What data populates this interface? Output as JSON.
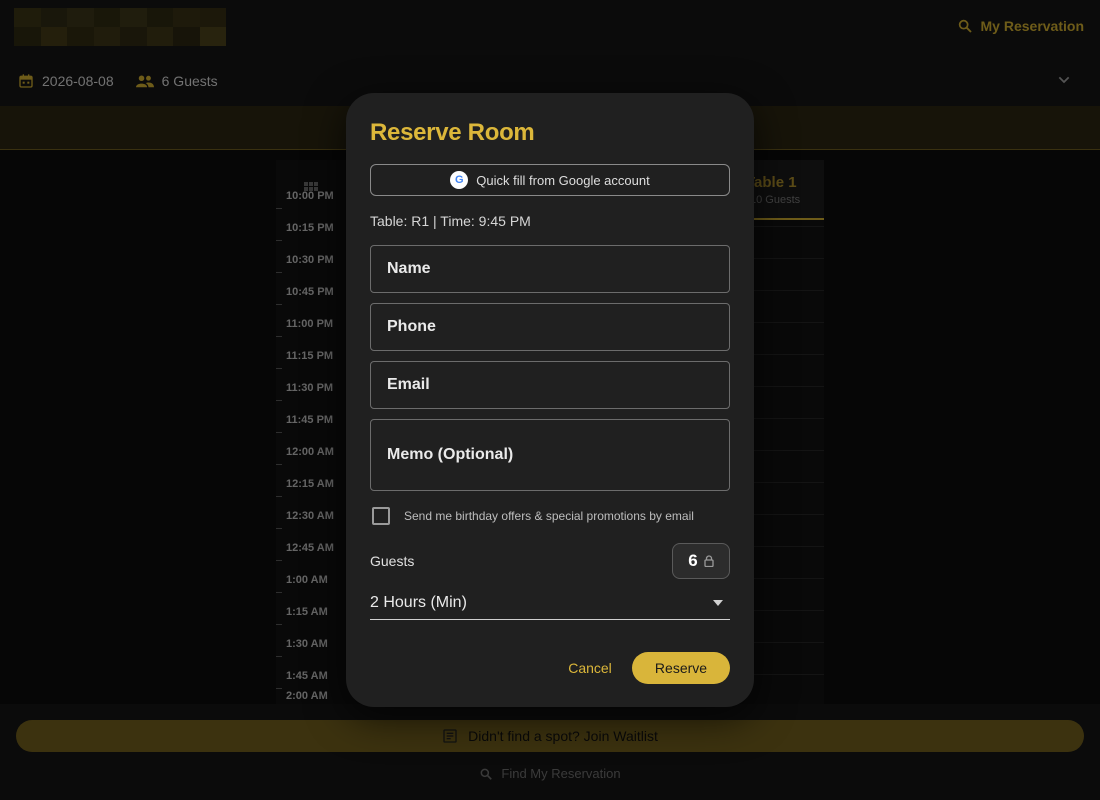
{
  "header": {
    "my_reservation_label": "My Reservation"
  },
  "filters": {
    "date": "2026-08-08",
    "guests": "6 Guests"
  },
  "grid": {
    "table_name": "Table 1",
    "table_capacity": "10 Guests",
    "times": [
      "10:00 PM",
      "10:15 PM",
      "10:30 PM",
      "10:45 PM",
      "11:00 PM",
      "11:15 PM",
      "11:30 PM",
      "11:45 PM",
      "12:00 AM",
      "12:15 AM",
      "12:30 AM",
      "12:45 AM",
      "1:00 AM",
      "1:15 AM",
      "1:30 AM",
      "1:45 AM",
      "2:00 AM"
    ]
  },
  "dialog": {
    "title": "Reserve Room",
    "quick_fill_label": "Quick fill from Google account",
    "google_badge": "G",
    "table_info": "Table: R1 | Time: 9:45 PM",
    "name_placeholder": "Name",
    "phone_placeholder": "Phone",
    "email_placeholder": "Email",
    "memo_placeholder": "Memo (Optional)",
    "promo_checkbox_label": "Send me birthday offers & special promotions by email",
    "promo_checked": false,
    "guests_label": "Guests",
    "guests_value": "6",
    "duration_value": "2 Hours (Min)",
    "cancel_label": "Cancel",
    "reserve_label": "Reserve"
  },
  "footer": {
    "waitlist_label": "Didn't find a spot? Join Waitlist",
    "find_reservation_label": "Find My Reservation"
  },
  "colors": {
    "accent_gold": "#dcb73a",
    "dialog_bg": "#202020",
    "page_bg": "#0b0b0b"
  }
}
